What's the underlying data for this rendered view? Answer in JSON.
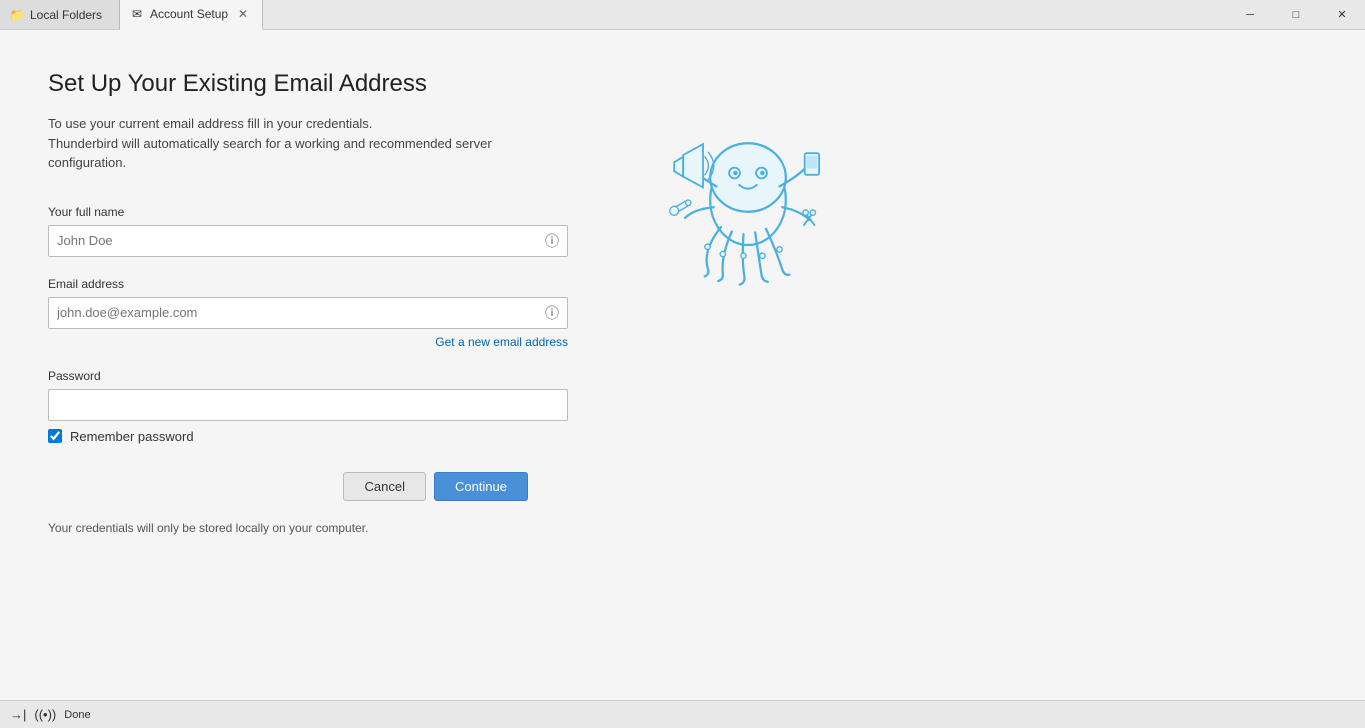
{
  "titlebar": {
    "tabs": [
      {
        "id": "local-folders",
        "label": "Local Folders",
        "icon": "📁",
        "active": false,
        "closeable": false
      },
      {
        "id": "account-setup",
        "label": "Account Setup",
        "icon": "✉",
        "active": true,
        "closeable": true
      }
    ],
    "controls": {
      "minimize": "─",
      "maximize": "□",
      "close": "✕"
    }
  },
  "page": {
    "title": "Set Up Your Existing Email Address",
    "description_line1": "To use your current email address fill in your credentials.",
    "description_line2": "Thunderbird will automatically search for a working and recommended server configuration.",
    "fields": {
      "fullname": {
        "label": "Your full name",
        "placeholder": "John Doe",
        "value": ""
      },
      "email": {
        "label": "Email address",
        "placeholder": "john.doe@example.com",
        "value": ""
      },
      "get_new_email_link": "Get a new email address",
      "password": {
        "label": "Password",
        "placeholder": "",
        "value": ""
      },
      "remember_password": {
        "label": "Remember password",
        "checked": true
      }
    },
    "buttons": {
      "cancel": "Cancel",
      "continue": "Continue"
    },
    "footer_note": "Your credentials will only be stored locally on your computer."
  },
  "statusbar": {
    "icons": [
      "→|",
      "((•))"
    ],
    "text": "Done"
  }
}
